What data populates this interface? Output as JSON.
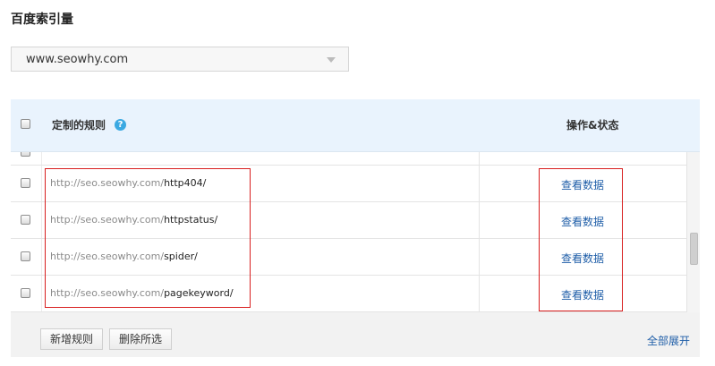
{
  "page_title": "百度索引量",
  "site_select": {
    "value": "www.seowhy.com"
  },
  "table": {
    "header_rule": "定制的规则",
    "header_op": "操作&状态",
    "help_glyph": "?",
    "rows": [
      {
        "prefix": "http://seo.seowhy.com/",
        "path": "http404/",
        "action": "查看数据"
      },
      {
        "prefix": "http://seo.seowhy.com/",
        "path": "httpstatus/",
        "action": "查看数据"
      },
      {
        "prefix": "http://seo.seowhy.com/",
        "path": "spider/",
        "action": "查看数据"
      },
      {
        "prefix": "http://seo.seowhy.com/",
        "path": "pagekeyword/",
        "action": "查看数据"
      }
    ]
  },
  "footer": {
    "add_rule": "新增规则",
    "delete_selected": "删除所选",
    "expand_all": "全部展开"
  },
  "colors": {
    "header_bg": "#e9f3fd",
    "link": "#1f5ea8",
    "highlight_border": "#d81e1e",
    "help_icon": "#3ba9e2"
  }
}
